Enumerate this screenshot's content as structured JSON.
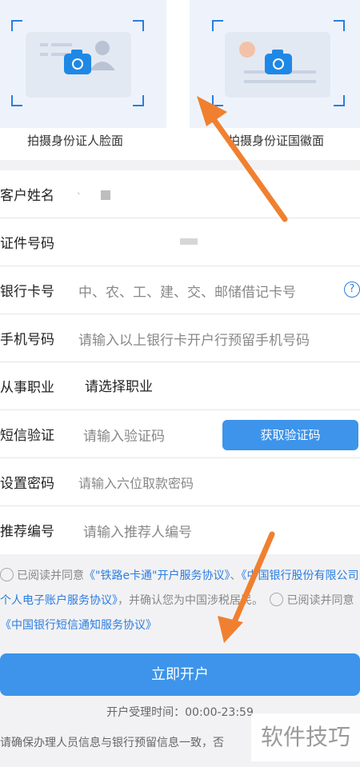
{
  "id_photos": {
    "front_caption": "拍摄身份证人脸面",
    "back_caption": "拍摄身份证国徽面"
  },
  "form": {
    "name": {
      "label": "客户姓名",
      "value": "ˎ"
    },
    "id_number": {
      "label": "证件号码",
      "value": ""
    },
    "bank_card": {
      "label": "银行卡号",
      "placeholder": "中、农、工、建、交、邮储借记卡号",
      "help_icon": "?"
    },
    "phone": {
      "label": "手机号码",
      "placeholder": "请输入以上银行卡开户行预留手机号码"
    },
    "occupation": {
      "label": "从事职业",
      "value": "请选择职业"
    },
    "sms": {
      "label": "短信验证",
      "placeholder": "请输入验证码",
      "button": "获取验证码"
    },
    "password": {
      "label": "设置密码",
      "placeholder": "请输入六位取款密码"
    },
    "referrer": {
      "label": "推荐编号",
      "placeholder": "请输入推荐人编号"
    }
  },
  "agreement": {
    "read_agree_1": "已阅读并同意",
    "link_1": "《\"铁路e卡通\"开户服务协议》",
    "sep": "、",
    "link_2": "《中国银行股份有限公司个人电子账户服务协议》",
    "confirm": "，并确认您为中国涉税居民。",
    "read_agree_2": "已阅读并同意",
    "link_3": "《中国银行短信通知服务协议》"
  },
  "open_button": "立即开户",
  "hours": "开户受理时间：00:00-23:59",
  "notice": "请确保办理人员信息与银行预留信息一致，否",
  "watermark": "软件技巧",
  "colors": {
    "accent": "#3d94ea",
    "link": "#2b7de0",
    "arrow": "#f08030"
  }
}
